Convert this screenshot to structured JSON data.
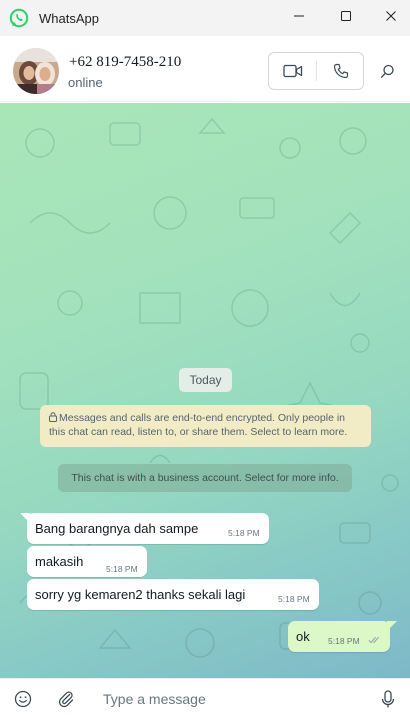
{
  "window": {
    "app_title": "WhatsApp"
  },
  "contact": {
    "name": "+62 819-7458-210",
    "status": "online"
  },
  "chat": {
    "date_label": "Today",
    "encryption_notice": "Messages and calls are end-to-end encrypted. Only people in this chat can read, listen to, or share them. Select to learn more.",
    "business_notice": "This chat is with a business account. Select for more info.",
    "messages": [
      {
        "direction": "incoming",
        "text": "Bang barangnya dah sampe",
        "time": "5:18 PM"
      },
      {
        "direction": "incoming",
        "text": "makasih",
        "time": "5:18 PM"
      },
      {
        "direction": "incoming",
        "text": "sorry yg kemaren2 thanks sekali lagi",
        "time": "5:18 PM"
      },
      {
        "direction": "outgoing",
        "text": "ok",
        "time": "5:18 PM",
        "status": "read"
      }
    ]
  },
  "composer": {
    "placeholder": "Type a message"
  },
  "icons": {
    "app_logo": "whatsapp-logo-icon",
    "minimize": "minimize-icon",
    "maximize": "maximize-icon",
    "close": "close-icon",
    "video_call": "video-call-icon",
    "voice_call": "phone-icon",
    "search": "search-icon",
    "lock": "lock-icon",
    "read_receipt": "double-check-icon",
    "emoji": "emoji-icon",
    "attach": "paperclip-icon",
    "mic": "microphone-icon"
  },
  "colors": {
    "brand": "#25d366",
    "outgoing_bubble": "#dbf8c6",
    "incoming_bubble": "#ffffff",
    "encryption_notice_bg": "#f1ecc5",
    "read_tick": "#53bdeb"
  }
}
